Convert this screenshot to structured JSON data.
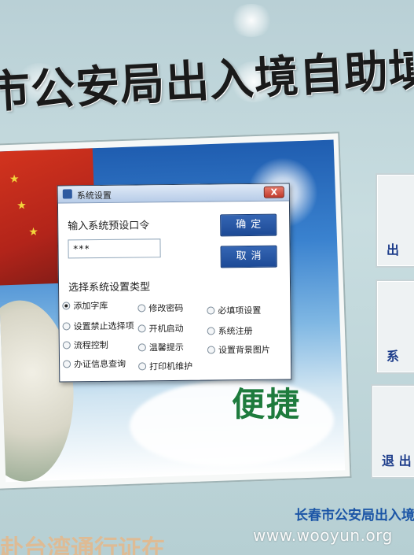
{
  "background": {
    "banner_title": "市公安局出入境自助填表系统",
    "slogan": "便捷",
    "side_buttons": [
      "出",
      "系",
      "退 出"
    ],
    "footer_text": "长春市公安局出入境",
    "bottom_text": "赴台湾通行证在",
    "watermark": "www.wooyun.org"
  },
  "dialog": {
    "title": "系统设置",
    "close_label": "X",
    "prompt_label": "输入系统预设口令",
    "password_value": "***",
    "ok_label": "确定",
    "cancel_label": "取消",
    "type_label": "选择系统设置类型",
    "options": [
      {
        "label": "添加字库",
        "checked": true
      },
      {
        "label": "修改密码",
        "checked": false
      },
      {
        "label": "必填项设置",
        "checked": false
      },
      {
        "label": "设置禁止选择项",
        "checked": false
      },
      {
        "label": "开机启动",
        "checked": false
      },
      {
        "label": "系统注册",
        "checked": false
      },
      {
        "label": "流程控制",
        "checked": false
      },
      {
        "label": "温馨提示",
        "checked": false
      },
      {
        "label": "设置背景图片",
        "checked": false
      },
      {
        "label": "办证信息查询",
        "checked": false
      },
      {
        "label": "打印机维护",
        "checked": false
      }
    ]
  },
  "colors": {
    "button_blue": "#1d4a96",
    "slogan_green": "#1e7b3d",
    "footer_blue": "#1b55a6"
  }
}
